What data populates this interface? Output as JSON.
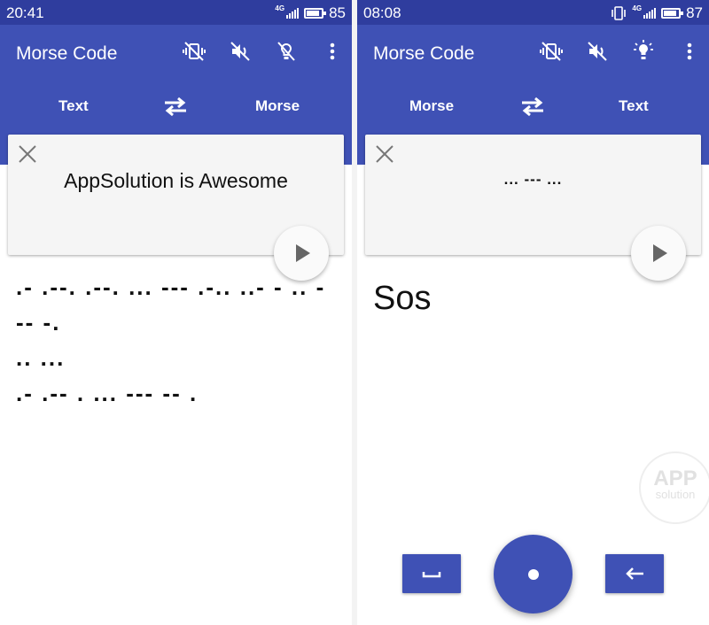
{
  "left": {
    "status": {
      "time": "20:41",
      "network": "4G",
      "battery": "85"
    },
    "app_title": "Morse Code",
    "lang_from": "Text",
    "lang_to": "Morse",
    "input_text": "AppSolution is Awesome",
    "output_lines": [
      ".- .--. .--. ... --- .-.. ..- - .. -",
      "-- -.",
      ".. ...",
      ".- .-- . ... --- -- ."
    ],
    "icons": [
      "vibrate-off-icon",
      "sound-off-icon",
      "flash-off-icon",
      "more-vert-icon",
      "swap-icon",
      "close-icon",
      "play-icon"
    ]
  },
  "right": {
    "status": {
      "time": "08:08",
      "network": "4G",
      "battery": "87"
    },
    "app_title": "Morse Code",
    "lang_from": "Morse",
    "lang_to": "Text",
    "input_text": "... --- ...",
    "output_text": "Sos",
    "watermark": {
      "line1": "APP",
      "line2": "solution"
    },
    "icons": [
      "vibrate-off-icon",
      "sound-off-icon",
      "flash-on-icon",
      "more-vert-icon",
      "swap-icon",
      "close-icon",
      "play-icon",
      "space-key-icon",
      "dot-icon",
      "backspace-icon"
    ]
  },
  "colors": {
    "primary": "#3f51b5",
    "status_bar": "#2f3d9e",
    "card": "#f5f5f5"
  }
}
